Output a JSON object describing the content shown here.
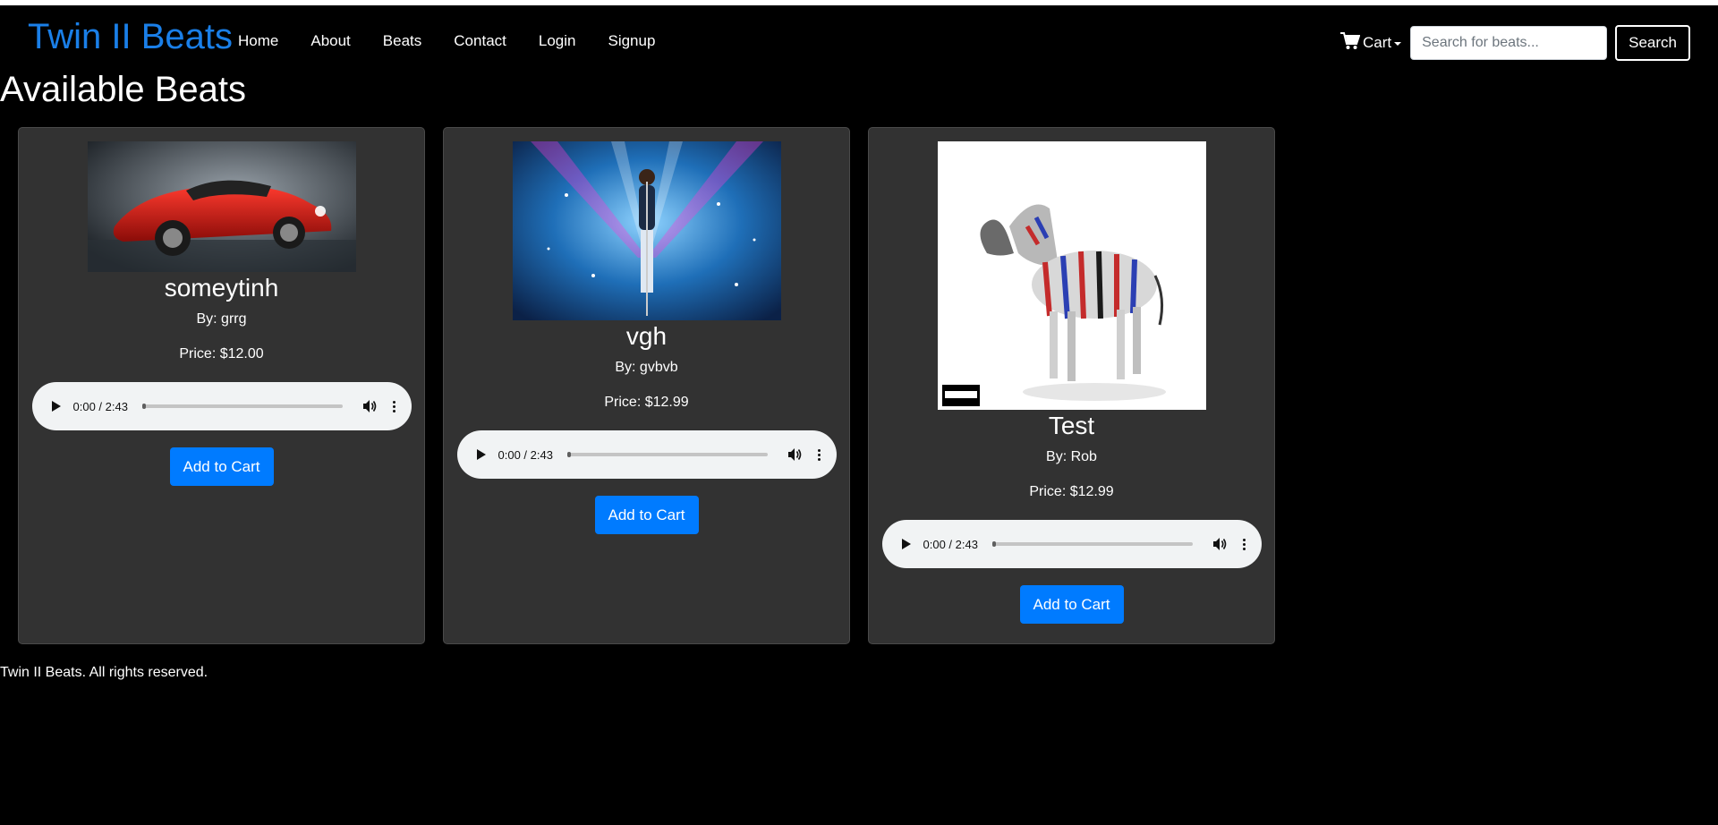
{
  "nav": {
    "brand": "Twin II Beats",
    "links": [
      "Home",
      "About",
      "Beats",
      "Contact",
      "Login",
      "Signup"
    ],
    "cart_label": "Cart",
    "search_placeholder": "Search for beats...",
    "search_button": "Search"
  },
  "page": {
    "title": "Available Beats"
  },
  "beats": [
    {
      "title": "someytinh",
      "by": "By: grrg",
      "price": "Price: $12.00",
      "time": "0:00 / 2:43",
      "progress": 0.02,
      "add_label": "Add to Cart"
    },
    {
      "title": "vgh",
      "by": "By: gvbvb",
      "price": "Price: $12.99",
      "time": "0:00 / 2:43",
      "progress": 0.02,
      "add_label": "Add to Cart"
    },
    {
      "title": "Test",
      "by": "By: Rob",
      "price": "Price: $12.99",
      "time": "0:00 / 2:43",
      "progress": 0.02,
      "add_label": "Add to Cart"
    }
  ],
  "footer": {
    "text": "Twin II Beats. All rights reserved."
  },
  "colors": {
    "brand": "#1a7fe8",
    "button": "#007bff",
    "card": "#323232",
    "background": "#000000"
  }
}
